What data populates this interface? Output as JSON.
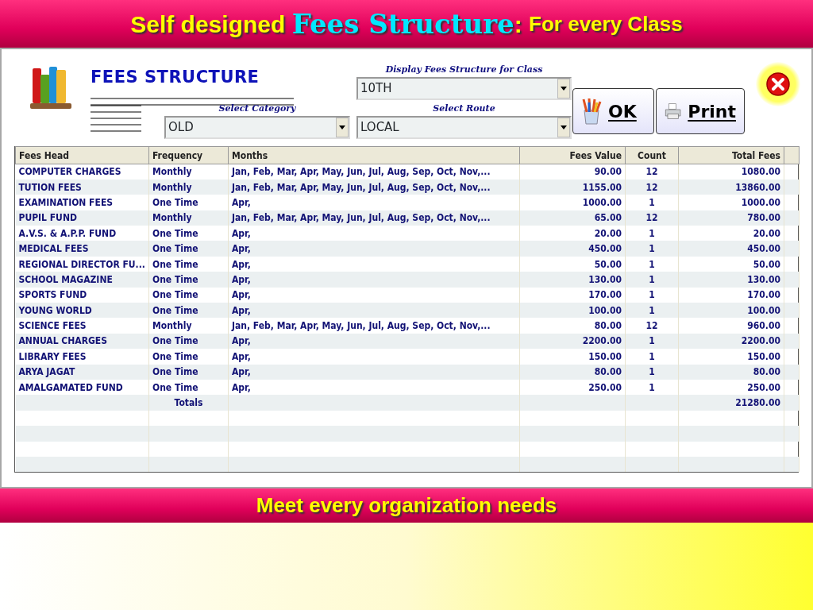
{
  "slide_title": [
    {
      "kind": "plain",
      "text": "Self designed "
    },
    {
      "kind": "highlight",
      "text": "Fees Structure"
    },
    {
      "kind": "plain",
      "text": ": "
    },
    {
      "kind": "small",
      "text": "For every Class"
    }
  ],
  "window": {
    "heading": "FEES STRUCTURE",
    "fields": [
      {
        "kind": "class",
        "label": "Display Fees Structure for Class",
        "value": "10TH"
      },
      {
        "kind": "category",
        "label": "Select Category",
        "value": "OLD"
      },
      {
        "kind": "route",
        "label": "Select Route",
        "value": "LOCAL"
      }
    ],
    "buttons": [
      {
        "kind": "ok",
        "label": "OK"
      },
      {
        "kind": "print",
        "label": "Print"
      }
    ],
    "table": {
      "columns": [
        "Fees Head",
        "Frequency",
        "Months",
        "Fees Value",
        "Count",
        "Total Fees"
      ],
      "rows": [
        {
          "kind": "data",
          "cells": [
            "COMPUTER CHARGES",
            "Monthly",
            "Jan, Feb, Mar, Apr, May, Jun, Jul, Aug, Sep, Oct, Nov,...",
            "90.00",
            "12",
            "1080.00"
          ]
        },
        {
          "kind": "data",
          "cells": [
            "TUTION FEES",
            "Monthly",
            "Jan, Feb, Mar, Apr, May, Jun, Jul, Aug, Sep, Oct, Nov,...",
            "1155.00",
            "12",
            "13860.00"
          ]
        },
        {
          "kind": "data",
          "cells": [
            "EXAMINATION FEES",
            "One Time",
            "Apr,",
            "1000.00",
            "1",
            "1000.00"
          ]
        },
        {
          "kind": "data",
          "cells": [
            "PUPIL FUND",
            "Monthly",
            "Jan, Feb, Mar, Apr, May, Jun, Jul, Aug, Sep, Oct, Nov,...",
            "65.00",
            "12",
            "780.00"
          ]
        },
        {
          "kind": "data",
          "cells": [
            "A.V.S. & A.P.P. FUND",
            "One Time",
            "Apr,",
            "20.00",
            "1",
            "20.00"
          ]
        },
        {
          "kind": "data",
          "cells": [
            "MEDICAL FEES",
            "One Time",
            "Apr,",
            "450.00",
            "1",
            "450.00"
          ]
        },
        {
          "kind": "data",
          "cells": [
            "REGIONAL DIRECTOR FU...",
            "One Time",
            "Apr,",
            "50.00",
            "1",
            "50.00"
          ]
        },
        {
          "kind": "data",
          "cells": [
            "SCHOOL MAGAZINE",
            "One Time",
            "Apr,",
            "130.00",
            "1",
            "130.00"
          ]
        },
        {
          "kind": "data",
          "cells": [
            "SPORTS FUND",
            "One Time",
            "Apr,",
            "170.00",
            "1",
            "170.00"
          ]
        },
        {
          "kind": "data",
          "cells": [
            "YOUNG WORLD",
            "One Time",
            "Apr,",
            "100.00",
            "1",
            "100.00"
          ]
        },
        {
          "kind": "data",
          "cells": [
            "SCIENCE FEES",
            "Monthly",
            "Jan, Feb, Mar, Apr, May, Jun, Jul, Aug, Sep, Oct, Nov,...",
            "80.00",
            "12",
            "960.00"
          ]
        },
        {
          "kind": "data",
          "cells": [
            "ANNUAL CHARGES",
            "One Time",
            "Apr,",
            "2200.00",
            "1",
            "2200.00"
          ]
        },
        {
          "kind": "data",
          "cells": [
            "LIBRARY FEES",
            "One Time",
            "Apr,",
            "150.00",
            "1",
            "150.00"
          ]
        },
        {
          "kind": "data",
          "cells": [
            "ARYA JAGAT",
            "One Time",
            "Apr,",
            "80.00",
            "1",
            "80.00"
          ]
        },
        {
          "kind": "data",
          "cells": [
            "AMALGAMATED FUND",
            "One Time",
            "Apr,",
            "250.00",
            "1",
            "250.00"
          ]
        },
        {
          "kind": "total",
          "label": "Totals",
          "total": "21280.00"
        },
        {
          "kind": "blank"
        },
        {
          "kind": "blank"
        },
        {
          "kind": "blank"
        },
        {
          "kind": "blank"
        }
      ]
    }
  },
  "slide_footer": "Meet every organization needs"
}
